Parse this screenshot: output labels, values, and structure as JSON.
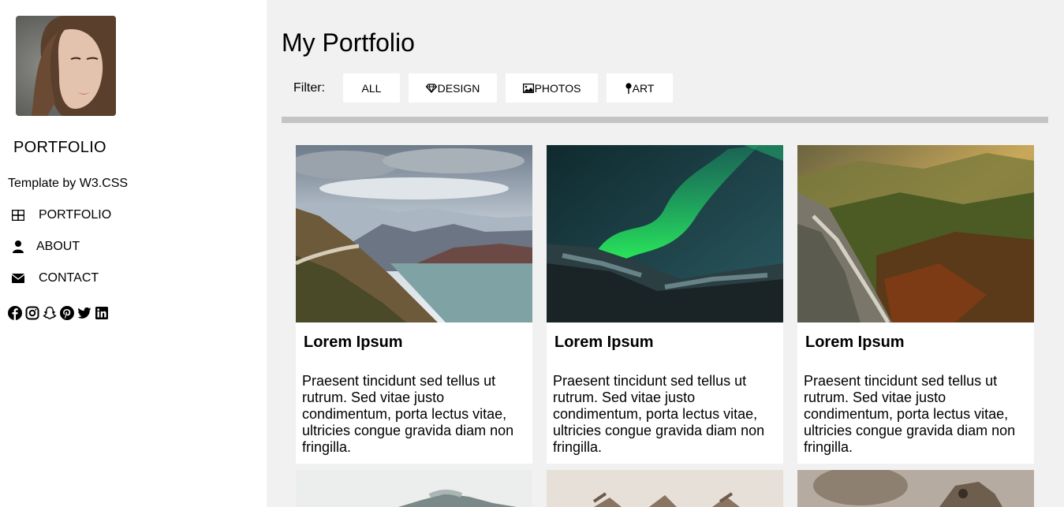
{
  "sidebar": {
    "brand": "PORTFOLIO",
    "tagline": "Template by W3.CSS",
    "nav": [
      {
        "label": "PORTFOLIO",
        "icon": "grid-icon"
      },
      {
        "label": "ABOUT",
        "icon": "user-icon"
      },
      {
        "label": "CONTACT",
        "icon": "envelope-icon"
      }
    ],
    "social": [
      "facebook-icon",
      "instagram-icon",
      "snapchat-icon",
      "pinterest-icon",
      "twitter-icon",
      "linkedin-icon"
    ]
  },
  "main": {
    "title": "My Portfolio",
    "filter_label": "Filter:",
    "filters": [
      {
        "label": "ALL",
        "icon": ""
      },
      {
        "label": "DESIGN",
        "icon": "diamond-icon"
      },
      {
        "label": "PHOTOS",
        "icon": "photo-icon"
      },
      {
        "label": "ART",
        "icon": "map-pin-icon"
      }
    ],
    "cards": [
      {
        "title": "Lorem Ipsum",
        "text": "Praesent tincidunt sed tellus ut rutrum. Sed vitae justo condimentum, porta lectus vitae, ultricies congue gravida diam non fringilla."
      },
      {
        "title": "Lorem Ipsum",
        "text": "Praesent tincidunt sed tellus ut rutrum. Sed vitae justo condimentum, porta lectus vitae, ultricies congue gravida diam non fringilla."
      },
      {
        "title": "Lorem Ipsum",
        "text": "Praesent tincidunt sed tellus ut rutrum. Sed vitae justo condimentum, porta lectus vitae, ultricies congue gravida diam non fringilla."
      }
    ]
  },
  "colors": {
    "sidebar_bg": "#ffffff",
    "main_bg": "#f1f1f1",
    "divider": "#c4c4c4"
  }
}
